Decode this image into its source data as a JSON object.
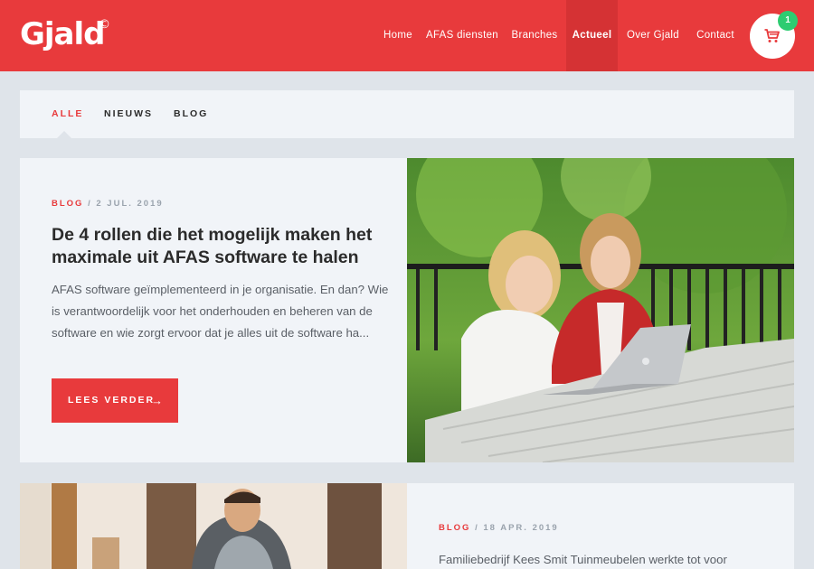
{
  "brand": {
    "logo": "Gjald",
    "mark": "©"
  },
  "nav": {
    "items": [
      {
        "label": "Home"
      },
      {
        "label": "AFAS diensten"
      },
      {
        "label": "Branches"
      },
      {
        "label": "Actueel"
      },
      {
        "label": "Over Gjald"
      },
      {
        "label": "Contact"
      }
    ],
    "active": "Actueel"
  },
  "cart": {
    "count": "1",
    "icon": "cart-icon"
  },
  "filters": {
    "items": [
      {
        "label": "ALLE"
      },
      {
        "label": "NIEUWS"
      },
      {
        "label": "BLOG"
      }
    ],
    "active": "ALLE"
  },
  "articles": [
    {
      "category": "BLOG",
      "date": "/ 2 JUL. 2019",
      "title": "De 4 rollen die het mogelijk maken het maximale uit AFAS software te halen",
      "excerpt": "AFAS software geïmplementeerd in je organisatie. En dan? Wie is verantwoordelijk voor het onderhouden en beheren van de software en wie zorgt ervoor dat je alles uit de software ha...",
      "button": "LEES VERDER",
      "button_icon": "arrow-right-icon"
    },
    {
      "category": "BLOG",
      "date": "/ 18 APR. 2019",
      "excerpt": "Familiebedrijf Kees Smit Tuinmeubelen werkte tot voor"
    }
  ],
  "colors": {
    "accent": "#e83a3c",
    "badge": "#2ecc71",
    "background": "#dfe4ea",
    "card": "#f1f4f8"
  }
}
